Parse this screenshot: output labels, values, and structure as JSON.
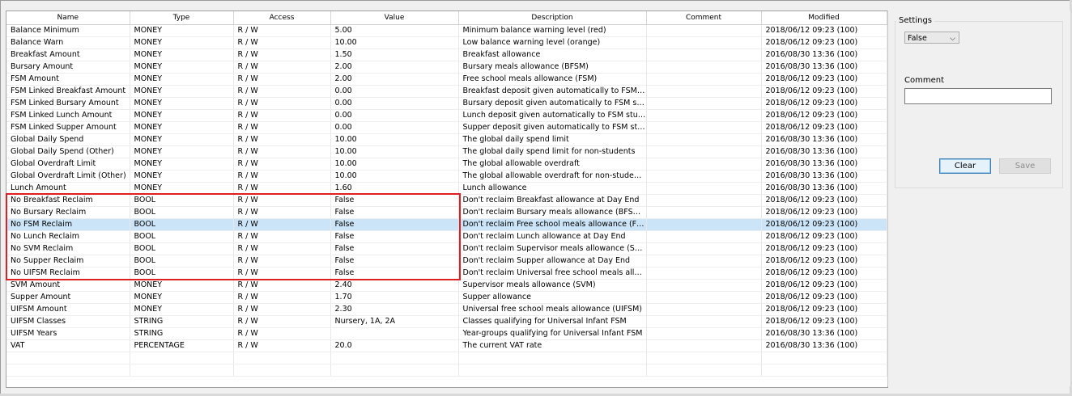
{
  "grid": {
    "columns": [
      {
        "label": "Name",
        "width": 152
      },
      {
        "label": "Type",
        "width": 128
      },
      {
        "label": "Access",
        "width": 120
      },
      {
        "label": "Value",
        "width": 158
      },
      {
        "label": "Description",
        "width": 232
      },
      {
        "label": "Comment",
        "width": 142
      },
      {
        "label": "Modified",
        "width": 155
      }
    ],
    "rows": [
      [
        "Balance Minimum",
        "MONEY",
        "R / W",
        "5.00",
        "Minimum balance warning level (red)",
        "",
        "2018/06/12 09:23 (100)"
      ],
      [
        "Balance Warn",
        "MONEY",
        "R / W",
        "10.00",
        "Low balance warning level (orange)",
        "",
        "2018/06/12 09:23 (100)"
      ],
      [
        "Breakfast Amount",
        "MONEY",
        "R / W",
        "1.50",
        "Breakfast allowance",
        "",
        "2016/08/30 13:36 (100)"
      ],
      [
        "Bursary Amount",
        "MONEY",
        "R / W",
        "2.00",
        "Bursary meals allowance (BFSM)",
        "",
        "2016/08/30 13:36 (100)"
      ],
      [
        "FSM Amount",
        "MONEY",
        "R / W",
        "2.00",
        "Free school meals allowance (FSM)",
        "",
        "2018/06/12 09:23 (100)"
      ],
      [
        "FSM Linked Breakfast Amount",
        "MONEY",
        "R / W",
        "0.00",
        "Breakfast deposit given automatically to FSM stud...",
        "",
        "2018/06/12 09:23 (100)"
      ],
      [
        "FSM Linked Bursary Amount",
        "MONEY",
        "R / W",
        "0.00",
        "Bursary deposit given automatically to FSM students",
        "",
        "2018/06/12 09:23 (100)"
      ],
      [
        "FSM Linked Lunch Amount",
        "MONEY",
        "R / W",
        "0.00",
        "Lunch deposit given automatically to FSM students",
        "",
        "2018/06/12 09:23 (100)"
      ],
      [
        "FSM Linked Supper Amount",
        "MONEY",
        "R / W",
        "0.00",
        "Supper deposit given automatically to FSM students",
        "",
        "2018/06/12 09:23 (100)"
      ],
      [
        "Global Daily Spend",
        "MONEY",
        "R / W",
        "10.00",
        "The global daily spend limit",
        "",
        "2016/08/30 13:36 (100)"
      ],
      [
        "Global Daily Spend (Other)",
        "MONEY",
        "R / W",
        "10.00",
        "The global daily spend limit for non-students",
        "",
        "2016/08/30 13:36 (100)"
      ],
      [
        "Global Overdraft Limit",
        "MONEY",
        "R / W",
        "10.00",
        "The global allowable overdraft",
        "",
        "2016/08/30 13:36 (100)"
      ],
      [
        "Global Overdraft Limit (Other)",
        "MONEY",
        "R / W",
        "10.00",
        "The global allowable overdraft for non-students",
        "",
        "2016/08/30 13:36 (100)"
      ],
      [
        "Lunch Amount",
        "MONEY",
        "R / W",
        "1.60",
        "Lunch allowance",
        "",
        "2016/08/30 13:36 (100)"
      ],
      [
        "No Breakfast Reclaim",
        "BOOL",
        "R / W",
        "False",
        "Don't reclaim Breakfast allowance at Day End",
        "",
        "2018/06/12 09:23 (100)"
      ],
      [
        "No Bursary Reclaim",
        "BOOL",
        "R / W",
        "False",
        "Don't reclaim Bursary meals allowance (BFSM) at ...",
        "",
        "2018/06/12 09:23 (100)"
      ],
      [
        "No FSM Reclaim",
        "BOOL",
        "R / W",
        "False",
        "Don't reclaim Free school meals allowance (FSM) ...",
        "",
        "2018/06/12 09:23 (100)"
      ],
      [
        "No Lunch Reclaim",
        "BOOL",
        "R / W",
        "False",
        "Don't reclaim Lunch allowance at Day End",
        "",
        "2018/06/12 09:23 (100)"
      ],
      [
        "No SVM Reclaim",
        "BOOL",
        "R / W",
        "False",
        "Don't reclaim Supervisor meals allowance (SVM) ...",
        "",
        "2018/06/12 09:23 (100)"
      ],
      [
        "No Supper Reclaim",
        "BOOL",
        "R / W",
        "False",
        "Don't reclaim Supper allowance at Day End",
        "",
        "2018/06/12 09:23 (100)"
      ],
      [
        "No UIFSM Reclaim",
        "BOOL",
        "R / W",
        "False",
        "Don't reclaim Universal free school meals allowan...",
        "",
        "2018/06/12 09:23 (100)"
      ],
      [
        "SVM Amount",
        "MONEY",
        "R / W",
        "2.40",
        "Supervisor meals allowance (SVM)",
        "",
        "2018/06/12 09:23 (100)"
      ],
      [
        "Supper Amount",
        "MONEY",
        "R / W",
        "1.70",
        "Supper allowance",
        "",
        "2018/06/12 09:23 (100)"
      ],
      [
        "UIFSM Amount",
        "MONEY",
        "R / W",
        "2.30",
        "Universal free school meals allowance (UIFSM)",
        "",
        "2018/06/12 09:23 (100)"
      ],
      [
        "UIFSM Classes",
        "STRING",
        "R / W",
        "Nursery, 1A, 2A",
        "Classes qualifying for Universal Infant FSM",
        "",
        "2018/06/12 09:23 (100)"
      ],
      [
        "UIFSM Years",
        "STRING",
        "R / W",
        "",
        "Year-groups qualifying for Universal Infant FSM",
        "",
        "2016/08/30 13:36 (100)"
      ],
      [
        "VAT",
        "PERCENTAGE",
        "R / W",
        "20.0",
        "The current VAT rate",
        "",
        "2016/08/30 13:36 (100)"
      ]
    ],
    "selected_row": "No FSM Reclaim",
    "empty_rows": 2
  },
  "settings": {
    "title": "Settings",
    "value": "False",
    "comment_label": "Comment",
    "comment_value": "",
    "clear_label": "Clear",
    "save_label": "Save"
  },
  "colors": {
    "highlight_box": "#e02020",
    "selected_row": "#cce4f7"
  }
}
